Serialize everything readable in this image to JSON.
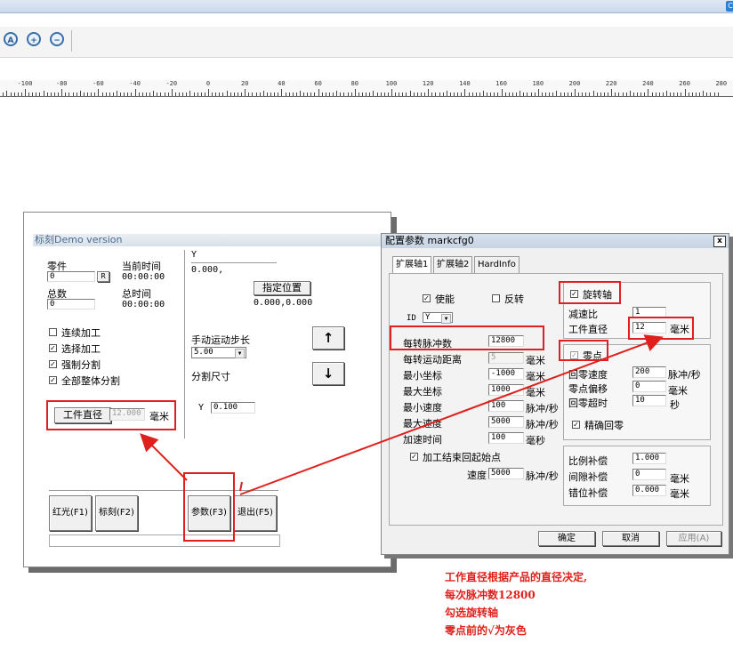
{
  "toolbar": {
    "icons": [
      "zoom-all-icon",
      "zoom-in-icon",
      "zoom-out-icon"
    ]
  },
  "ruler": {
    "labels": [
      "-100",
      "-80",
      "-60",
      "-40",
      "-20",
      "0",
      "20",
      "40",
      "60",
      "80",
      "100",
      "120",
      "140",
      "160",
      "180",
      "200",
      "220",
      "240",
      "260",
      "280"
    ]
  },
  "left": {
    "title": "标刻Demo version",
    "part_label": "零件",
    "part_value": "0",
    "r_button": "R",
    "current_time_label": "当前时间",
    "current_time_value": "00:00:00",
    "total_label": "总数",
    "total_value": "0",
    "total_time_label": "总时间",
    "total_time_value": "00:00:00",
    "y_label": "Y",
    "y_value": "0.000,",
    "set_position_button": "指定位置",
    "position_value": "0.000,0.000",
    "cb_continuous": "连续加工",
    "cb_select": "选择加工",
    "cb_force_split": "强制分割",
    "cb_all_split": "全部整体分割",
    "manual_step_label": "手动运动步长",
    "manual_step_value": "5.00",
    "split_size_label": "分割尺寸",
    "split_y_label": "Y",
    "split_y_value": "0.100",
    "up_arrow": "↑",
    "down_arrow": "↓",
    "workpiece_diameter_button": "工件直径",
    "workpiece_diameter_value": "12.000",
    "workpiece_diameter_unit": "毫米",
    "btn_red": "红光(F1)",
    "btn_mark": "标刻(F2)",
    "btn_params": "参数(F3)",
    "btn_exit": "退出(F5)"
  },
  "right": {
    "title": "配置参数 markcfg0",
    "close": "x",
    "tabs": [
      "扩展轴1",
      "扩展轴2",
      "HardInfo"
    ],
    "enable_label": "使能",
    "reverse_label": "反转",
    "id_label": "ID",
    "id_value": "Y",
    "pulses_label": "每转脉冲数",
    "pulses_value": "12800",
    "distance_label": "每转运动距离",
    "distance_value": "5",
    "distance_unit": "毫米",
    "min_coord_label": "最小坐标",
    "min_coord_value": "-1000",
    "min_coord_unit": "毫米",
    "max_coord_label": "最大坐标",
    "max_coord_value": "1000",
    "max_coord_unit": "毫米",
    "min_speed_label": "最小速度",
    "min_speed_value": "100",
    "min_speed_unit": "脉冲/秒",
    "max_speed_label": "最大速度",
    "max_speed_value": "5000",
    "max_speed_unit": "脉冲/秒",
    "accel_label": "加速时间",
    "accel_value": "100",
    "accel_unit": "毫秒",
    "return_start_label": "加工结束回起始点",
    "speed_label": "速度",
    "speed_value": "5000",
    "speed_unit": "脉冲/秒",
    "rotary_label": "旋转轴",
    "reduction_label": "减速比",
    "reduction_value": "1",
    "work_diam_label": "工件直径",
    "work_diam_value": "12",
    "work_diam_unit": "毫米",
    "zero_label": "零点",
    "home_speed_label": "回零速度",
    "home_speed_value": "200",
    "home_speed_unit": "脉冲/秒",
    "zero_offset_label": "零点偏移",
    "zero_offset_value": "0",
    "zero_offset_unit": "毫米",
    "home_timeout_label": "回零超时",
    "home_timeout_value": "10",
    "home_timeout_unit": "秒",
    "precise_home_label": "精确回零",
    "ratio_comp_label": "比例补偿",
    "ratio_comp_value": "1.000",
    "gap_comp_label": "间隙补偿",
    "gap_comp_value": "0",
    "gap_comp_unit": "毫米",
    "misalign_comp_label": "错位补偿",
    "misalign_comp_value": "0.000",
    "misalign_comp_unit": "毫米",
    "ok_button": "确定",
    "cancel_button": "取消",
    "apply_button": "应用(A)"
  },
  "notes": [
    "工作直径根据产品的直径决定,",
    "每次脉冲数12800",
    "勾选旋转轴",
    "零点前的√为灰色"
  ],
  "colors": {
    "annotation_red": "#e0201c",
    "title_blue": "#4a6a8e"
  }
}
